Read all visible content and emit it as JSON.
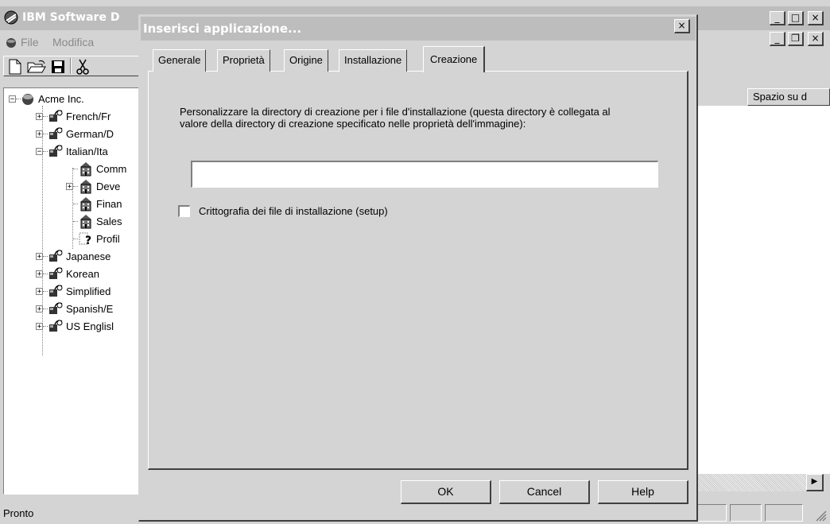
{
  "app": {
    "title": "IBM Software D",
    "menu": [
      "File",
      "Modifica"
    ],
    "toolbar_icons": [
      "new-file-icon",
      "open-folder-icon",
      "save-icon",
      "cut-icon"
    ],
    "column_header": "Spazio su d",
    "status_text": "Pronto",
    "tree": {
      "root": "Acme Inc.",
      "items": [
        {
          "label": "French/Fr",
          "expander": "+"
        },
        {
          "label": "German/D",
          "expander": "+"
        },
        {
          "label": "Italian/Ita",
          "expander": "−"
        },
        {
          "label": "Comm",
          "expander": ""
        },
        {
          "label": "Deve",
          "expander": "+"
        },
        {
          "label": "Finan",
          "expander": ""
        },
        {
          "label": "Sales",
          "expander": ""
        },
        {
          "label": "Profil",
          "expander": ""
        },
        {
          "label": "Japanese",
          "expander": "+"
        },
        {
          "label": "Korean",
          "expander": "+"
        },
        {
          "label": "Simplified",
          "expander": "+"
        },
        {
          "label": "Spanish/E",
          "expander": "+"
        },
        {
          "label": "US Englisl",
          "expander": "+"
        }
      ]
    }
  },
  "dialog": {
    "title": "Inserisci applicazione...",
    "tabs": [
      "Generale",
      "Proprietà",
      "Origine",
      "Installazione",
      "Creazione"
    ],
    "active_tab": "Creazione",
    "description": "Personalizzare la directory di creazione per i file d'installazione (questa directory è collegata al valore della directory di creazione specificato nelle proprietà dell'immagine):",
    "directory_value": "",
    "checkbox_label": "Crittografia dei file di installazione (setup)",
    "checkbox_checked": false,
    "buttons": {
      "ok": "OK",
      "cancel": "Cancel",
      "help": "Help"
    }
  }
}
